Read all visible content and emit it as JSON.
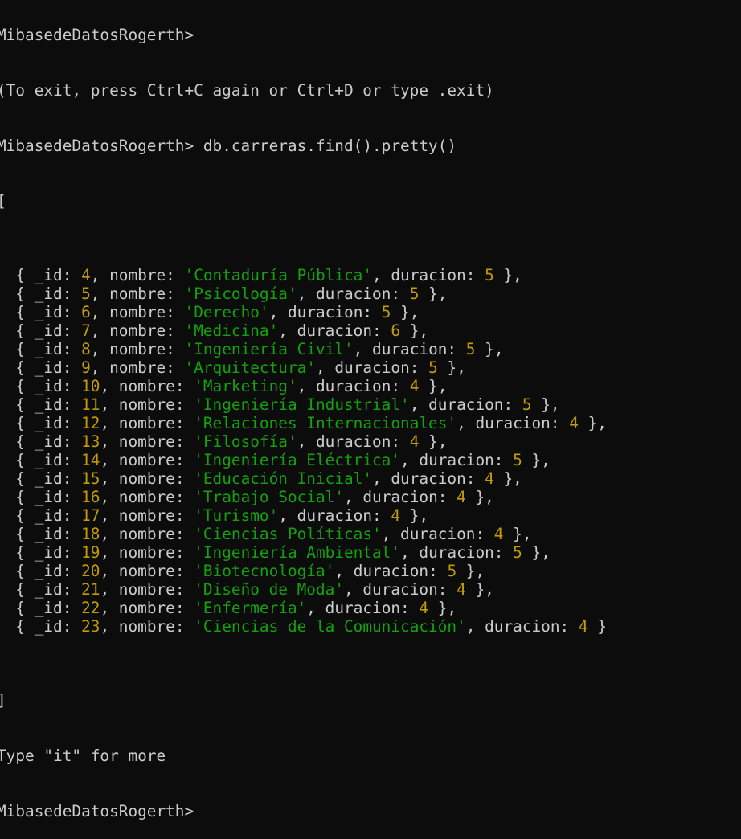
{
  "terminal": {
    "prompt": "MibasedeDatosRogerth>",
    "exit_hint": "(To exit, press Ctrl+C again or Ctrl+D or type .exit)",
    "command": "db.carreras.find().pretty()",
    "open_bracket": "[",
    "close_bracket": "]",
    "more_hint": "Type \"it\" for more",
    "colors": {
      "background": "#0c0c0c",
      "text": "#cccccc",
      "string": "#13a10e",
      "number": "#c19c00"
    },
    "records": [
      {
        "id": "4",
        "nombre": "'Contaduría Pública'",
        "duracion": "5"
      },
      {
        "id": "5",
        "nombre": "'Psicología'",
        "duracion": "5"
      },
      {
        "id": "6",
        "nombre": "'Derecho'",
        "duracion": "5"
      },
      {
        "id": "7",
        "nombre": "'Medicina'",
        "duracion": "6"
      },
      {
        "id": "8",
        "nombre": "'Ingeniería Civil'",
        "duracion": "5"
      },
      {
        "id": "9",
        "nombre": "'Arquitectura'",
        "duracion": "5"
      },
      {
        "id": "10",
        "nombre": "'Marketing'",
        "duracion": "4"
      },
      {
        "id": "11",
        "nombre": "'Ingeniería Industrial'",
        "duracion": "5"
      },
      {
        "id": "12",
        "nombre": "'Relaciones Internacionales'",
        "duracion": "4"
      },
      {
        "id": "13",
        "nombre": "'Filosofía'",
        "duracion": "4"
      },
      {
        "id": "14",
        "nombre": "'Ingeniería Eléctrica'",
        "duracion": "5"
      },
      {
        "id": "15",
        "nombre": "'Educación Inicial'",
        "duracion": "4"
      },
      {
        "id": "16",
        "nombre": "'Trabajo Social'",
        "duracion": "4"
      },
      {
        "id": "17",
        "nombre": "'Turismo'",
        "duracion": "4"
      },
      {
        "id": "18",
        "nombre": "'Ciencias Políticas'",
        "duracion": "4"
      },
      {
        "id": "19",
        "nombre": "'Ingeniería Ambiental'",
        "duracion": "5"
      },
      {
        "id": "20",
        "nombre": "'Biotecnología'",
        "duracion": "5"
      },
      {
        "id": "21",
        "nombre": "'Diseño de Moda'",
        "duracion": "4"
      },
      {
        "id": "22",
        "nombre": "'Enfermería'",
        "duracion": "4"
      },
      {
        "id": "23",
        "nombre": "'Ciencias de la Comunicación'",
        "duracion": "4"
      }
    ],
    "record_syntax": {
      "open": "  { ",
      "id_key": "_id: ",
      "sep1": ", ",
      "nombre_key": "nombre: ",
      "sep2": ", ",
      "duracion_key": "duracion: ",
      "close": " },",
      "close_last": " }"
    }
  }
}
